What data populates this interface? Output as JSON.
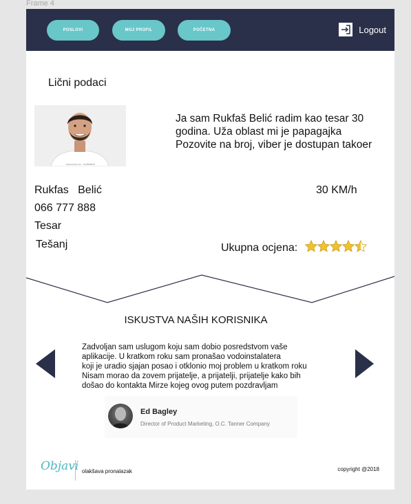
{
  "frame_label": "Frame 4",
  "nav": {
    "buttons": [
      "POSLOVI",
      "MOJ PROFIL",
      "POČETNA"
    ],
    "logout_label": "Logout"
  },
  "profile": {
    "section_title": "Lični podaci",
    "photo_caption": "shutterstock.com · 1615566040",
    "bio": "Ja sam Rukfaš Belić radim kao tesar 30 godina. Uža oblast mi je papagajka Pozovite na broj, viber je dostupan takoer",
    "name": "Rukfas   Belić",
    "phone": "066 777 888",
    "occupation": "Tesar",
    "city": "Tešanj",
    "price": "30 KM/h",
    "rating_label": "Ukupna ocjena:",
    "rating": 4.5,
    "rating_max": 5,
    "star_color": "#f2c12e"
  },
  "testimonials": {
    "title": "ISKUSTVA NAŠIH KORISNIKA",
    "lines": [
      "Zadvoljan sam uslugom koju sam dobio posredstvom vaše",
      "aplikacije. U kratkom roku sam pronašao vodoinstalatera",
      "koji je uradio sjajan posao i otklonio moj problem u kratkom roku",
      "Nisam morao da zovem prijatelje, a prijatelji, prijatelje kako bih",
      "došao do kontakta Mirze kojeg ovog putem pozdravljam"
    ],
    "author_name": "Ed Bagley",
    "author_role": "Director of Product Marketing, O.C. Tanner Company"
  },
  "footer": {
    "logo_text": "Objavi",
    "tagline": "olakšava pronalazak",
    "copyright": "copyright @2018"
  },
  "colors": {
    "navbar": "#2a3049",
    "accent": "#69c6c9",
    "logo": "#4bb7c2"
  }
}
